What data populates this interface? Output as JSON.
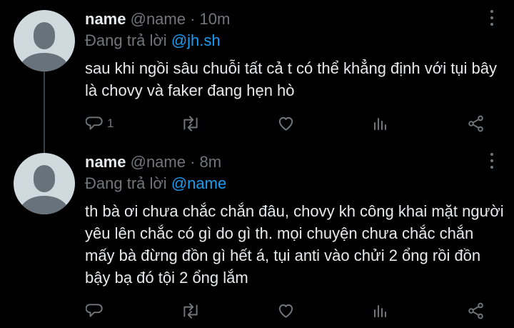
{
  "tweets": [
    {
      "name": "name",
      "handle": "@name",
      "time": "· 10m",
      "replying_prefix": "Đang trả lời",
      "replying_to": "@jh.sh",
      "text": "sau khi ngồi sâu chuỗi tất cả t có thể khẳng định với tụi bây là chovy và faker đang hẹn hò",
      "reply_count": "1"
    },
    {
      "name": "name",
      "handle": "@name",
      "time": "· 8m",
      "replying_prefix": "Đang trả lời",
      "replying_to": "@name",
      "text": "th bà ơi chưa chắc chắn đâu, chovy kh công khai mặt người yêu lên chắc có gì do gì th. mọi chuyện chưa chắc chắn mấy bà đừng đồn gì hết á, tụi anti vào chửi 2 ổng rồi đồn bậy bạ đó tội 2 ổng lắm",
      "reply_count": ""
    }
  ],
  "icons": [
    "reply-icon",
    "retweet-icon",
    "like-icon",
    "analytics-icon",
    "share-icon",
    "more-icon"
  ],
  "colors": {
    "background": "#000000",
    "text": "#e7e9ea",
    "muted": "#71767b",
    "link": "#1d9bf0",
    "avatar_bg": "#cfd9de",
    "avatar_fg": "#67727a"
  }
}
